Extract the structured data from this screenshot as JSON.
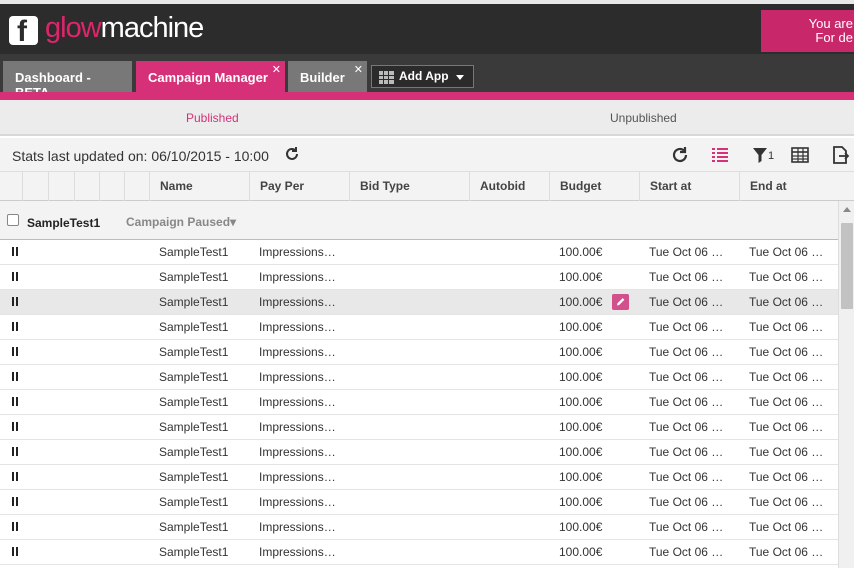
{
  "brand": {
    "glow": "glow",
    "machine": "machine",
    "f": "f"
  },
  "notice": {
    "line1": "You are",
    "line2": "For de"
  },
  "tabs": [
    {
      "label": "Dashboard - BETA"
    },
    {
      "label": "Campaign Manager"
    },
    {
      "label": "Builder"
    }
  ],
  "add_app": {
    "label": "Add App"
  },
  "subtabs": {
    "published": "Published",
    "unpublished": "Unpublished"
  },
  "toolbar": {
    "stats": "Stats last updated on: 06/10/2015 - 10:00",
    "filter_count": "1"
  },
  "columns": [
    "Name",
    "Pay Per",
    "Bid Type",
    "Autobid",
    "Budget",
    "Start at",
    "End at"
  ],
  "group": {
    "name": "SampleTest1",
    "status": "Campaign Paused▾"
  },
  "colors": {
    "accent": "#d63178",
    "header": "#2c2c2c"
  },
  "rows": [
    {
      "name": "SampleTest1",
      "pay_per": "Impressions…",
      "budget": "100.00€",
      "start": "Tue Oct 06 …",
      "end": "Tue Oct 06 …"
    },
    {
      "name": "SampleTest1",
      "pay_per": "Impressions…",
      "budget": "100.00€",
      "start": "Tue Oct 06 …",
      "end": "Tue Oct 06 …"
    },
    {
      "name": "SampleTest1",
      "pay_per": "Impressions…",
      "budget": "100.00€",
      "start": "Tue Oct 06 …",
      "end": "Tue Oct 06 …"
    },
    {
      "name": "SampleTest1",
      "pay_per": "Impressions…",
      "budget": "100.00€",
      "start": "Tue Oct 06 …",
      "end": "Tue Oct 06 …"
    },
    {
      "name": "SampleTest1",
      "pay_per": "Impressions…",
      "budget": "100.00€",
      "start": "Tue Oct 06 …",
      "end": "Tue Oct 06 …"
    },
    {
      "name": "SampleTest1",
      "pay_per": "Impressions…",
      "budget": "100.00€",
      "start": "Tue Oct 06 …",
      "end": "Tue Oct 06 …"
    },
    {
      "name": "SampleTest1",
      "pay_per": "Impressions…",
      "budget": "100.00€",
      "start": "Tue Oct 06 …",
      "end": "Tue Oct 06 …"
    },
    {
      "name": "SampleTest1",
      "pay_per": "Impressions…",
      "budget": "100.00€",
      "start": "Tue Oct 06 …",
      "end": "Tue Oct 06 …"
    },
    {
      "name": "SampleTest1",
      "pay_per": "Impressions…",
      "budget": "100.00€",
      "start": "Tue Oct 06 …",
      "end": "Tue Oct 06 …"
    },
    {
      "name": "SampleTest1",
      "pay_per": "Impressions…",
      "budget": "100.00€",
      "start": "Tue Oct 06 …",
      "end": "Tue Oct 06 …"
    },
    {
      "name": "SampleTest1",
      "pay_per": "Impressions…",
      "budget": "100.00€",
      "start": "Tue Oct 06 …",
      "end": "Tue Oct 06 …"
    },
    {
      "name": "SampleTest1",
      "pay_per": "Impressions…",
      "budget": "100.00€",
      "start": "Tue Oct 06 …",
      "end": "Tue Oct 06 …"
    },
    {
      "name": "SampleTest1",
      "pay_per": "Impressions…",
      "budget": "100.00€",
      "start": "Tue Oct 06 …",
      "end": "Tue Oct 06 …"
    }
  ]
}
